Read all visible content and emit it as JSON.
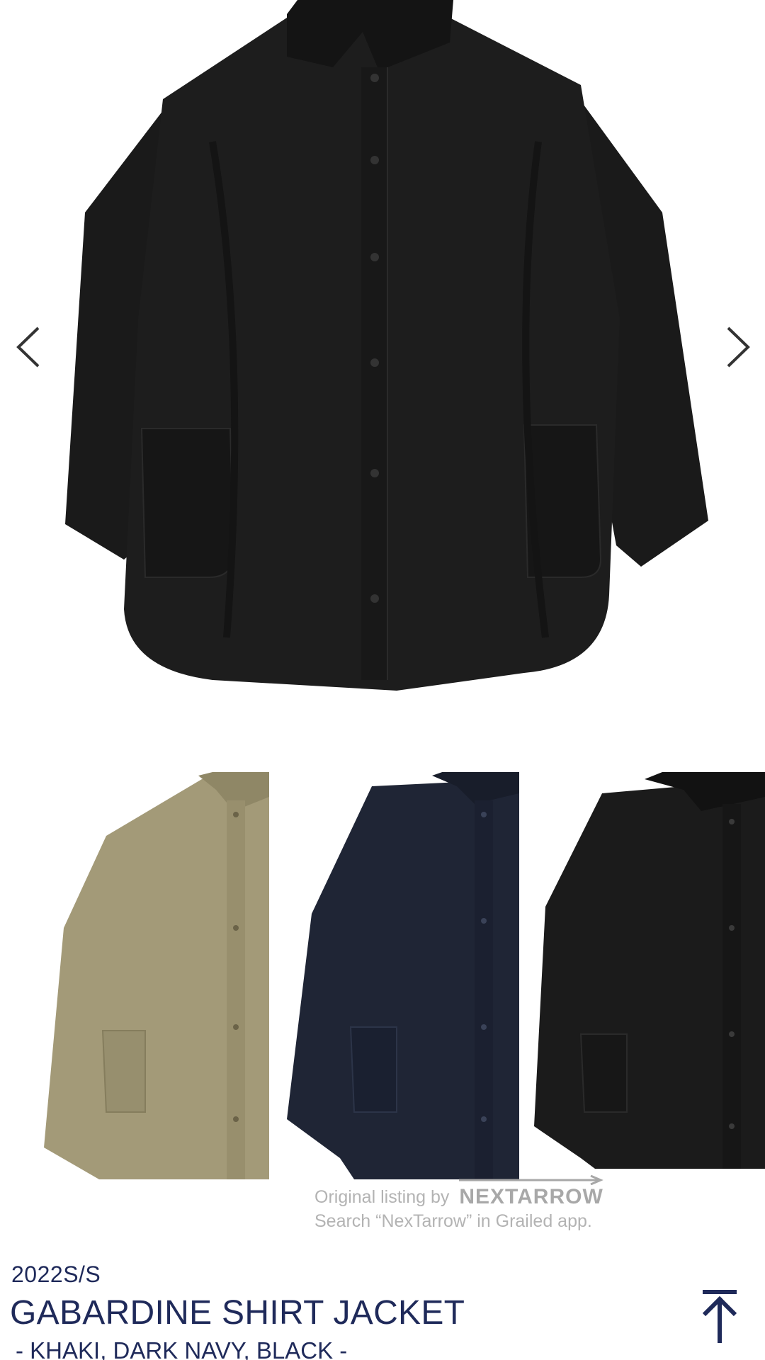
{
  "carousel": {
    "prev_icon": "chevron-left-icon",
    "next_icon": "chevron-right-icon"
  },
  "variants": [
    {
      "color_name": "KHAKI",
      "color": "#a39a78"
    },
    {
      "color_name": "DARK NAVY",
      "color": "#1f2535"
    },
    {
      "color_name": "BLACK",
      "color": "#1b1b1b"
    }
  ],
  "watermark": {
    "prefix": "Original listing by",
    "brand": "NEXTARROW",
    "search_hint": "Search “NexTarrow” in Grailed app."
  },
  "product": {
    "season": "2022S/S",
    "title": "GABARDINE SHIRT JACKET",
    "colors_line": "- KHAKI, DARK NAVY, BLACK -"
  },
  "scroll_top": {
    "icon": "arrow-to-top-icon",
    "color": "#1f2a5a"
  },
  "colors": {
    "text_accent": "#1f2a5a",
    "watermark": "#b3b3b3"
  }
}
